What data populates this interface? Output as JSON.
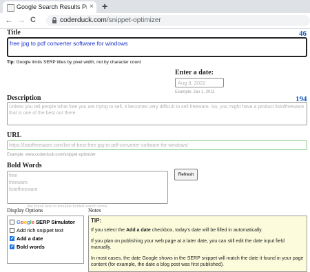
{
  "browser": {
    "tab_title": "Google Search Results Preview T",
    "tab_close": "×",
    "new_tab": "+",
    "back": "←",
    "forward": "→",
    "reload": "C",
    "lock": "🔒",
    "url_host": "coderduck.com",
    "url_path": "/snippet-optimizer"
  },
  "title_section": {
    "label": "Title",
    "count": "46",
    "value": "free jpg to pdf converter software for windows",
    "tip_bold": "Tip:",
    "tip": "Google limits SERP titles by pixel width, not by character count"
  },
  "date_section": {
    "label": "Enter a date:",
    "value": "Aug 9, 2022",
    "example": "Example:  Jan 1, 2011"
  },
  "description_section": {
    "label": "Description",
    "count": "194",
    "value": "Unless you tell people what free you are trying to sell, it becomes very difficult to sell freeware. So, you might have a product listoffreeware that is one of the best out there"
  },
  "url_section": {
    "label": "URL",
    "value": "https://listoffreeware.com/list-of-best-free-jpg-to-pdf-converter-software-for-windows/",
    "example": "Example:  www.coderduck.com/snippet-optimizer"
  },
  "bold_section": {
    "label": "Bold Words",
    "words": [
      "free",
      "freeware",
      "listoffreeware"
    ],
    "hint": "…line break here to simulate bolded search terms.",
    "refresh_label": "Refresh"
  },
  "display_options": {
    "label": "Display Options",
    "options": [
      {
        "label_prefix": "",
        "google": "Google",
        "label": " SERP Simulator",
        "checked": false
      },
      {
        "label": "Add rich snippet text",
        "checked": false
      },
      {
        "label": "Add a date",
        "checked": true
      },
      {
        "label": "Bold words",
        "checked": true
      }
    ]
  },
  "notes": {
    "label": "Notes",
    "tip_title": "TIP:",
    "p1_prefix": "If you select the ",
    "p1_bold": "Add a date",
    "p1_suffix": " checkbox, today's date will be filled in automatically.",
    "p2": "If you plan on publishing your web page at a later date, you can still edit the date input field manually.",
    "p3": "In most cases, the date Google shows in the SERP snippet will match the date it found in your page content (for example, the date a blog post was first published)."
  },
  "colors": {
    "accent": "#1a5bbd",
    "notes_bg": "#fcfcdc",
    "url_green": "#3fa34d"
  }
}
